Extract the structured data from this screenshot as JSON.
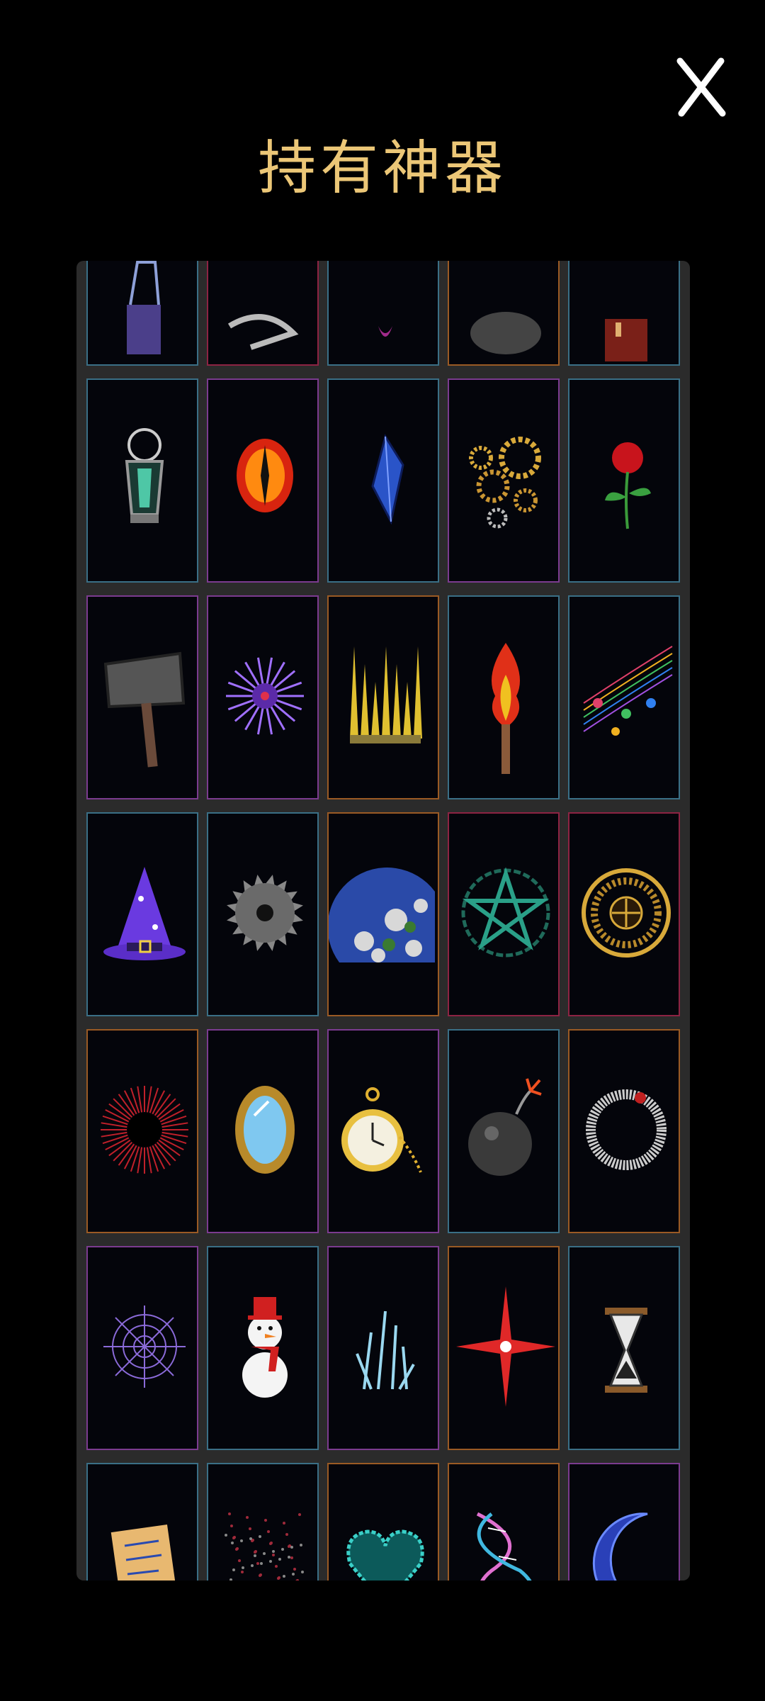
{
  "header": {
    "title": "持有神器",
    "close_icon": "close-x-icon"
  },
  "colors": {
    "blue": "#3a6f86",
    "purple": "#7b3b8f",
    "orange": "#9a5a24",
    "red": "#8d2343"
  },
  "artifacts": [
    {
      "icon": "harp-icon",
      "border": "blue"
    },
    {
      "icon": "bone-claw-icon",
      "border": "red"
    },
    {
      "icon": "purple-flame-icon",
      "border": "blue"
    },
    {
      "icon": "stone-rubble-icon",
      "border": "orange"
    },
    {
      "icon": "red-cloth-icon",
      "border": "blue"
    },
    {
      "icon": "lantern-icon",
      "border": "blue"
    },
    {
      "icon": "fiery-eye-icon",
      "border": "purple"
    },
    {
      "icon": "blue-crystal-icon",
      "border": "blue"
    },
    {
      "icon": "gears-icon",
      "border": "purple"
    },
    {
      "icon": "rose-icon",
      "border": "blue"
    },
    {
      "icon": "war-hammer-icon",
      "border": "purple"
    },
    {
      "icon": "purple-spiky-orb-icon",
      "border": "purple"
    },
    {
      "icon": "golden-spikes-icon",
      "border": "orange"
    },
    {
      "icon": "torch-icon",
      "border": "blue"
    },
    {
      "icon": "music-notes-icon",
      "border": "blue"
    },
    {
      "icon": "wizard-hat-icon",
      "border": "blue"
    },
    {
      "icon": "saw-blade-icon",
      "border": "blue"
    },
    {
      "icon": "planet-earth-icon",
      "border": "orange"
    },
    {
      "icon": "pentagram-icon",
      "border": "red"
    },
    {
      "icon": "golden-clock-dial-icon",
      "border": "red"
    },
    {
      "icon": "black-hole-icon",
      "border": "orange"
    },
    {
      "icon": "gold-mirror-icon",
      "border": "purple"
    },
    {
      "icon": "pocket-watch-icon",
      "border": "purple"
    },
    {
      "icon": "bomb-icon",
      "border": "blue"
    },
    {
      "icon": "ouroboros-icon",
      "border": "orange"
    },
    {
      "icon": "spider-web-icon",
      "border": "purple"
    },
    {
      "icon": "snowman-icon",
      "border": "blue"
    },
    {
      "icon": "ice-crystals-icon",
      "border": "purple"
    },
    {
      "icon": "red-star-icon",
      "border": "orange"
    },
    {
      "icon": "hourglass-icon",
      "border": "blue"
    },
    {
      "icon": "scroll-icon",
      "border": "blue"
    },
    {
      "icon": "red-dust-icon",
      "border": "blue"
    },
    {
      "icon": "cyan-heart-icon",
      "border": "orange"
    },
    {
      "icon": "dna-helix-icon",
      "border": "orange"
    },
    {
      "icon": "crescent-moon-icon",
      "border": "purple"
    }
  ]
}
